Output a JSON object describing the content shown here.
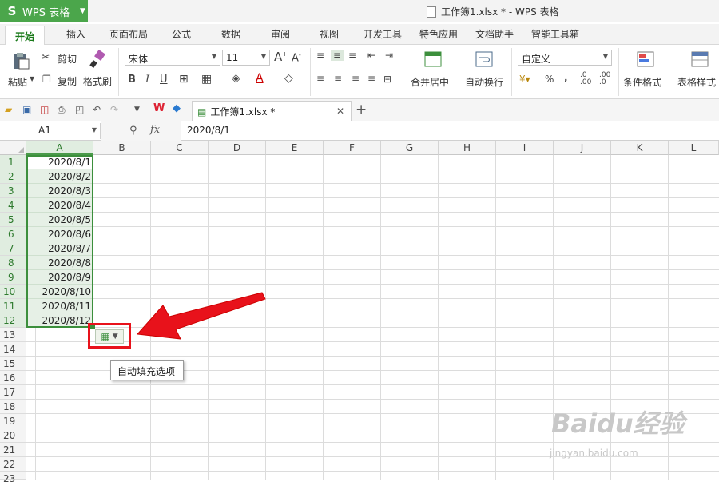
{
  "app": {
    "name": "WPS 表格",
    "logo": "S",
    "title": "工作簿1.xlsx * - WPS 表格"
  },
  "tabs": [
    "开始",
    "插入",
    "页面布局",
    "公式",
    "数据",
    "审阅",
    "视图",
    "开发工具",
    "特色应用",
    "文档助手",
    "智能工具箱"
  ],
  "ribbon": {
    "cut": "剪切",
    "copy": "复制",
    "paste": "粘贴",
    "format_painter": "格式刷",
    "font": "宋体",
    "size": "11",
    "bold": "B",
    "italic": "I",
    "underline": "U",
    "font_color": "A",
    "merge_center": "合并居中",
    "wrap_text": "自动换行",
    "number_format": "自定义",
    "percent": "%",
    "comma": ",",
    "dec_inc": ".00\n.0",
    "conditional_format": "条件格式",
    "table_style": "表格样式"
  },
  "doc_tab": {
    "label": "工作簿1.xlsx *"
  },
  "formula_bar": {
    "cell_ref": "A1",
    "value": "2020/8/1"
  },
  "columns": [
    "A",
    "B",
    "C",
    "D",
    "E",
    "F",
    "G",
    "H",
    "I",
    "J",
    "K",
    "L"
  ],
  "rows": [
    "1",
    "2",
    "3",
    "4",
    "5",
    "6",
    "7",
    "8",
    "9",
    "10",
    "11",
    "12",
    "13",
    "14",
    "15",
    "16",
    "17",
    "18",
    "19",
    "20",
    "21",
    "22",
    "23"
  ],
  "cells_A": [
    "2020/8/1",
    "2020/8/2",
    "2020/8/3",
    "2020/8/4",
    "2020/8/5",
    "2020/8/6",
    "2020/8/7",
    "2020/8/8",
    "2020/8/9",
    "2020/8/10",
    "2020/8/11",
    "2020/8/12"
  ],
  "tooltip": "自动填充选项",
  "watermark": {
    "main": "Baidu经验",
    "sub": "jingyan.baidu.com"
  },
  "colors": {
    "accent": "#4ba64b",
    "highlight": "#e8121b"
  }
}
